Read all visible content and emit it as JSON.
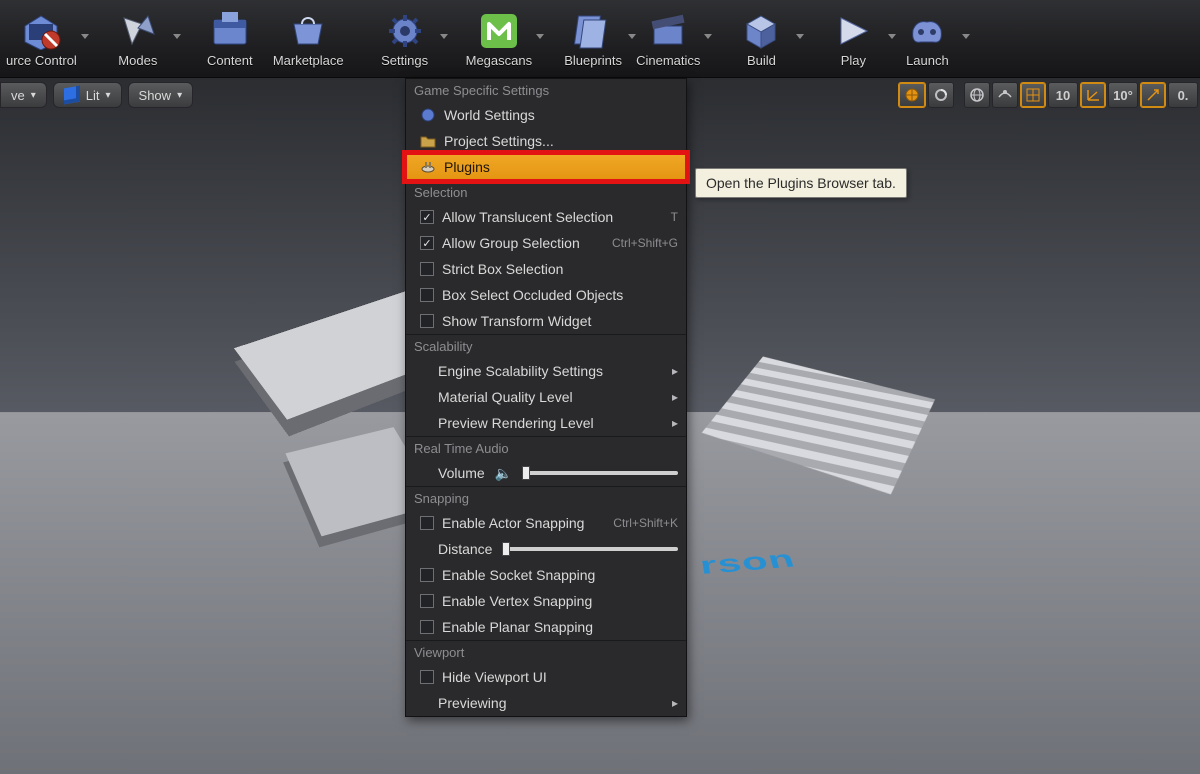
{
  "toolbar": {
    "source_control": "urce Control",
    "modes": "Modes",
    "content": "Content",
    "marketplace": "Marketplace",
    "settings": "Settings",
    "megascans": "Megascans",
    "blueprints": "Blueprints",
    "cinematics": "Cinematics",
    "build": "Build",
    "play": "Play",
    "launch": "Launch"
  },
  "pills": {
    "ve": "ve",
    "lit": "Lit",
    "show": "Show"
  },
  "right_widgets": {
    "num1": "10",
    "angle": "10°",
    "num2": "0."
  },
  "tooltip": "Open the Plugins Browser tab.",
  "floor_text": "rson",
  "menu": {
    "game_specific": {
      "header": "Game Specific Settings",
      "world_settings": "World Settings",
      "project_settings": "Project Settings...",
      "plugins": "Plugins"
    },
    "selection": {
      "header": "Selection",
      "allow_translucent": "Allow Translucent Selection",
      "allow_translucent_sc": "T",
      "allow_group": "Allow Group Selection",
      "allow_group_sc": "Ctrl+Shift+G",
      "strict_box": "Strict Box Selection",
      "box_occluded": "Box Select Occluded Objects",
      "show_transform": "Show Transform Widget"
    },
    "scalability": {
      "header": "Scalability",
      "engine": "Engine Scalability Settings",
      "material": "Material Quality Level",
      "preview": "Preview Rendering Level"
    },
    "audio": {
      "header": "Real Time Audio",
      "volume": "Volume"
    },
    "snapping": {
      "header": "Snapping",
      "enable_actor": "Enable Actor Snapping",
      "enable_actor_sc": "Ctrl+Shift+K",
      "distance": "Distance",
      "enable_socket": "Enable Socket Snapping",
      "enable_vertex": "Enable Vertex Snapping",
      "enable_planar": "Enable Planar Snapping"
    },
    "viewport": {
      "header": "Viewport",
      "hide_ui": "Hide Viewport UI",
      "previewing": "Previewing"
    }
  }
}
